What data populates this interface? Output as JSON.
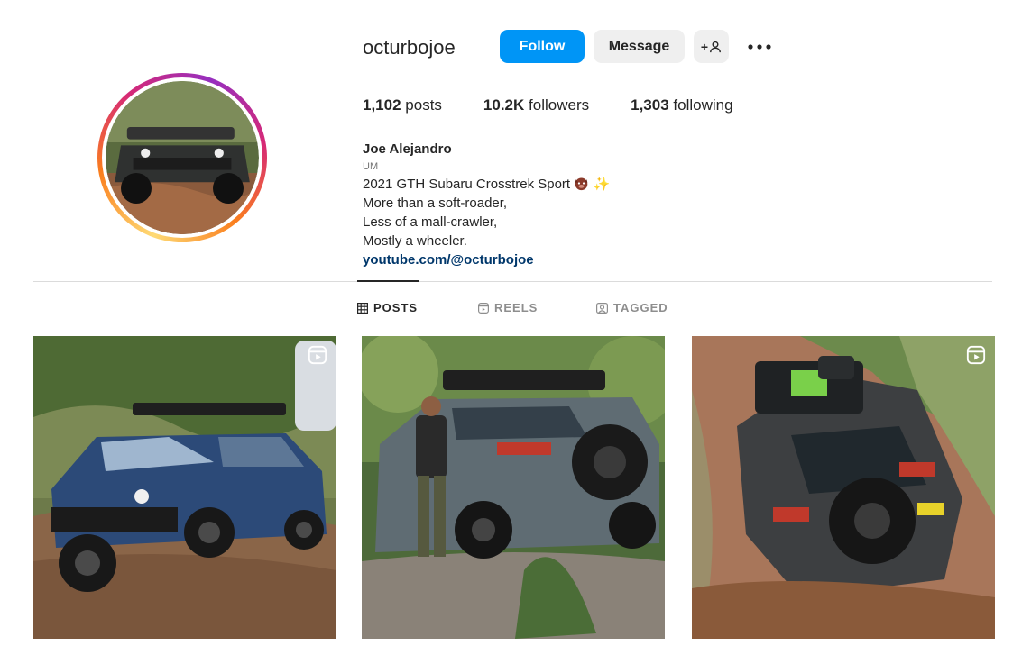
{
  "profile": {
    "username": "octurbojoe",
    "follow_label": "Follow",
    "message_label": "Message",
    "adduser_label": "+"
  },
  "stats": {
    "posts_count": "1,102",
    "posts_label": "posts",
    "followers_count": "10.2K",
    "followers_label": "followers",
    "following_count": "1,303",
    "following_label": "following"
  },
  "bio": {
    "full_name": "Joe Alejandro",
    "category": "UM",
    "line1": "2021 GTH Subaru Crosstrek Sport",
    "line1_emoji": "✨",
    "line2": "More than a soft-roader,",
    "line3": "Less of a mall-crawler,",
    "line4": "Mostly a wheeler.",
    "link": "youtube.com/@octurbojoe"
  },
  "tabs": [
    {
      "label": "POSTS",
      "active": true
    },
    {
      "label": "REELS",
      "active": false
    },
    {
      "label": "TAGGED",
      "active": false
    }
  ],
  "posts": [
    {
      "is_reel": true
    },
    {
      "is_reel": false
    },
    {
      "is_reel": true
    }
  ],
  "colors": {
    "accent": "#0095f6",
    "link": "#00376b",
    "secondary_button": "#efefef"
  }
}
